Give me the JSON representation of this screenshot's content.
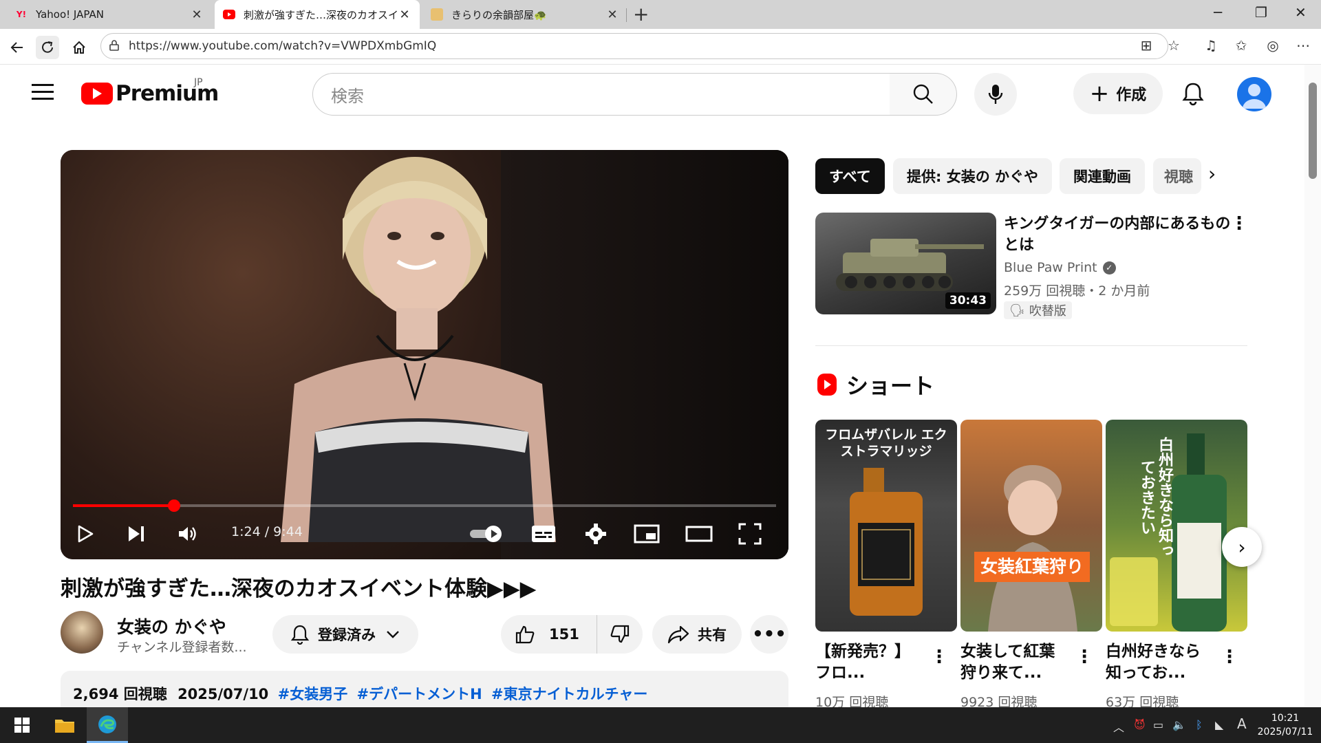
{
  "browser": {
    "tabs": [
      {
        "title": "Yahoo! JAPAN",
        "favicon": "Y!"
      },
      {
        "title": "刺激が強すぎた…深夜のカオスイベント",
        "favicon": "youtube"
      },
      {
        "title": "きらりの余韻部屋🐢",
        "favicon": "emoji"
      }
    ],
    "new_tab": "+",
    "window_controls": {
      "minimize": "─",
      "maximize": "❐",
      "close": "✕"
    },
    "url": "https://www.youtube.com/watch?v=VWPDXmbGmIQ"
  },
  "youtube": {
    "logo_text": "Premium",
    "region": "JP",
    "search_placeholder": "検索",
    "create_label": "作成",
    "accent_color": "#ff0000"
  },
  "player": {
    "time": "1:24 / 9:44",
    "progress_fraction": 0.144
  },
  "video": {
    "title": "刺激が強すぎた…深夜のカオスイベント体験▶︎▶︎▶︎",
    "channel_name": "女装の かぐや",
    "channel_subs": "チャンネル登録者数...",
    "subscribe_label": "登録済み",
    "likes": "151",
    "share_label": "共有",
    "views": "2,694 回視聴",
    "date": "2025/07/10",
    "hashtags": [
      "#女装男子",
      "#デパートメントH",
      "#東京ナイトカルチャー"
    ]
  },
  "sidebar": {
    "chips": [
      "すべて",
      "提供: 女装の かぐや",
      "関連動画",
      "視聴"
    ],
    "recommendation": {
      "title": "キングタイガーの内部にあるものとは",
      "channel": "Blue Paw Print",
      "meta": "259万 回視聴・2 か月前",
      "badge": "吹替版",
      "duration": "30:43"
    },
    "shorts_header": "ショート",
    "shorts": [
      {
        "title": "【新発売？】 フロ...",
        "views": "10万 回視聴",
        "overlay": "フロムザバレル エクストラマリッジ"
      },
      {
        "title": "女装して紅葉狩り来て...",
        "views": "9923 回視聴",
        "overlay": "女装紅葉狩り"
      },
      {
        "title": "白州好きなら知ってお...",
        "views": "63万 回視聴",
        "overlay": "白州好きなら知っておきたい"
      }
    ]
  },
  "taskbar": {
    "time": "10:21",
    "date": "2025/07/11",
    "ime": "A"
  }
}
